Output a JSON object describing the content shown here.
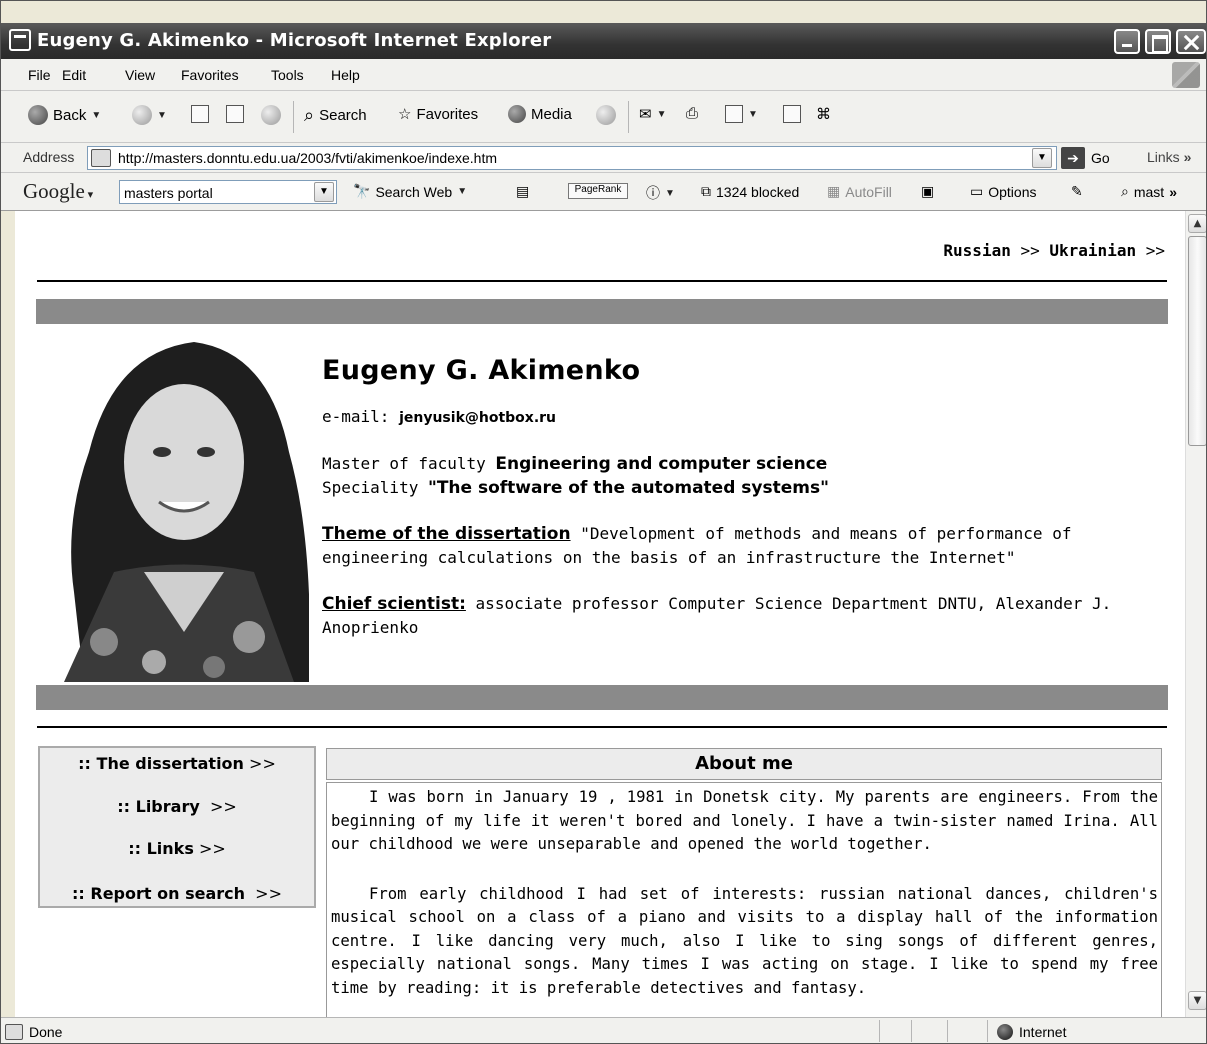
{
  "window": {
    "title": "Eugeny G. Akimenko - Microsoft Internet Explorer"
  },
  "menu": [
    "File",
    "Edit",
    "View",
    "Favorites",
    "Tools",
    "Help"
  ],
  "toolbar": {
    "back": "Back",
    "search": "Search",
    "favorites": "Favorites",
    "media": "Media"
  },
  "address": {
    "label": "Address",
    "url": "http://masters.donntu.edu.ua/2003/fvti/akimenkoe/indexe.htm",
    "go": "Go",
    "links": "Links"
  },
  "googlebar": {
    "logo": "Google",
    "search_value": "masters portal",
    "search_web": "Search Web",
    "pagerank": "PageRank",
    "blocked": "1324 blocked",
    "autofill": "AutoFill",
    "options": "Options",
    "mast": "mast"
  },
  "page": {
    "lang_russian": "Russian",
    "lang_ukrainian": "Ukrainian",
    "lang_arrow": ">>",
    "name": "Eugeny G. Akimenko",
    "email_label": "e-mail:",
    "email": "jenyusik@hotbox.ru",
    "master_label": "Master of faculty",
    "faculty": "Engineering and computer science",
    "speciality_label": "Speciality",
    "speciality": "\"The software of the automated systems\"",
    "theme_label": "Theme of the dissertation",
    "theme": "\"Development of methods and means of performance of engineering calculations on the basis of an infrastructure the Internet\"",
    "chief_label": "Chief scientist:",
    "chief": "associate professor Computer Science Department DNTU, Alexander J. Anoprienko"
  },
  "nav": [
    {
      "label": ":: The dissertation",
      "arrow": ">>"
    },
    {
      "label": ":: Library",
      "arrow": ">>"
    },
    {
      "label": ":: Links",
      "arrow": ">>"
    },
    {
      "label": ":: Report on search",
      "arrow": ">>"
    }
  ],
  "about": {
    "heading": "About me",
    "p1": "I was born in January 19 , 1981 in Donetsk city. My parents are engineers. From the beginning of my life it weren't bored and lonely. I have a twin-sister named Irina. All our childhood we were unseparable and opened the world together.",
    "p2": "From early childhood I had set of interests: russian national dances, children's musical school on a class of a piano and visits to a display hall of the information centre. I like dancing very much, also I like to sing songs of different genres, especially national songs. Many times I was acting on stage. I like to spend my free time by reading: it is preferable detectives and fantasy."
  },
  "status": {
    "text": "Done",
    "zone": "Internet"
  }
}
